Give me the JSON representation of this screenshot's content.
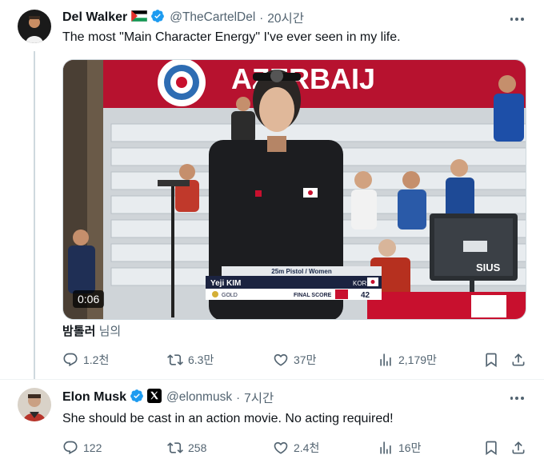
{
  "tweet1": {
    "author_name": "Del Walker",
    "handle": "@TheCartelDel",
    "time": "20시간",
    "text": "The most \"Main Character Energy\" I've ever seen in my life.",
    "video": {
      "duration": "0:06",
      "banner_text": "AZERBAIJ",
      "scoreboard_event": "25m Pistol / Women",
      "scoreboard_name": "Yeji KIM",
      "scoreboard_country": "KOR",
      "scoreboard_medal": "GOLD",
      "scoreboard_final_label": "FINAL SCORE",
      "scoreboard_score": "42",
      "monitor_brand": "SIUS"
    },
    "source_name": "밤톨러",
    "source_suffix": " 님의",
    "replies": "1.2천",
    "reposts": "6.3만",
    "likes": "37만",
    "views": "2,179만"
  },
  "tweet2": {
    "author_name": "Elon Musk",
    "handle": "@elonmusk",
    "time": "7시간",
    "text": "She should be cast in an action movie. No  acting required!",
    "replies": "122",
    "reposts": "258",
    "likes": "2.4천",
    "views": "16만"
  },
  "colors": {
    "verified_blue": "#1d9bf0",
    "text_primary": "#0f1419",
    "text_secondary": "#536471"
  }
}
